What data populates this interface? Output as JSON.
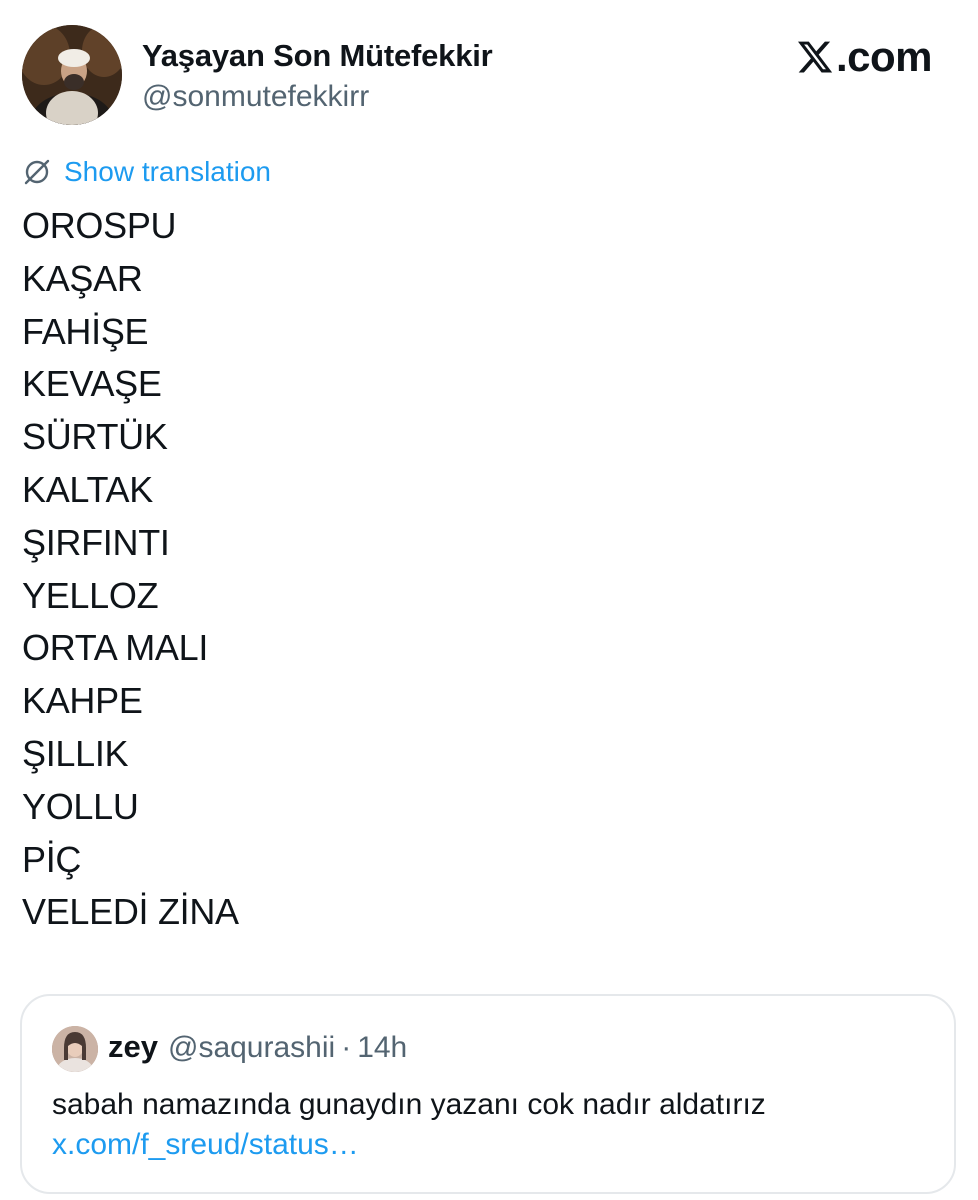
{
  "post": {
    "author": {
      "display_name": "Yaşayan Son Mütefekkir",
      "handle": "@sonmutefekkirr"
    },
    "brand": {
      "text": ".com",
      "icon": "x-logo-icon"
    },
    "translate": {
      "icon": "globe-slash-icon",
      "label": "Show translation"
    },
    "lines": [
      "OROSPU",
      "KAŞAR",
      "FAHİŞE",
      "KEVAŞE",
      "SÜRTÜK",
      "KALTAK",
      "ŞIRFINTI",
      "YELLOZ",
      "ORTA MALI",
      "KAHPE",
      "ŞILLIK",
      "YOLLU",
      "PİÇ",
      "VELEDİ ZİNA"
    ]
  },
  "quote": {
    "author": {
      "name": "zey",
      "handle": "@saqurashii",
      "separator": "·",
      "time": "14h"
    },
    "text": "sabah namazında gunaydın yazanı cok nadır aldatırız",
    "link": "x.com/f_sreud/status…"
  },
  "colors": {
    "text": "#0f1419",
    "secondary": "#536471",
    "link": "#1d9bf0",
    "border": "#e5e8eb",
    "background": "#ffffff"
  }
}
